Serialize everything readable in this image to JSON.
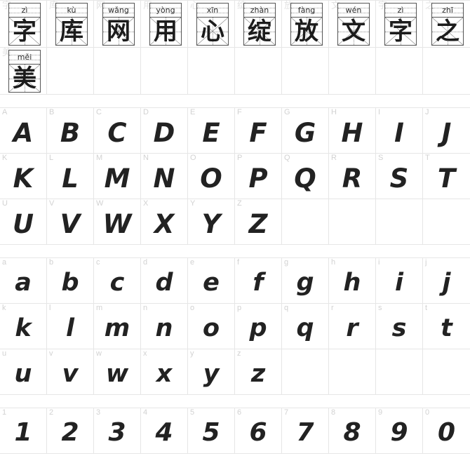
{
  "document": {
    "title": "Font specimen chart",
    "type": "font-preview-sheet"
  },
  "colors": {
    "grid_line": "#e6e6e6",
    "corner_label": "#d2d2d2",
    "glyph": "#222222",
    "cjk_glyph": "#1c1c1c",
    "box_border": "#555555",
    "guide_line": "#8e8e8e",
    "background": "#ffffff"
  },
  "cjk_section": {
    "name": "chinese-characters",
    "columns": 10,
    "cells": [
      {
        "char": "字",
        "pinyin": "zì"
      },
      {
        "char": "库",
        "pinyin": "kù"
      },
      {
        "char": "网",
        "pinyin": "wǎng"
      },
      {
        "char": "用",
        "pinyin": "yòng"
      },
      {
        "char": "心",
        "pinyin": "xīn"
      },
      {
        "char": "绽",
        "pinyin": "zhàn"
      },
      {
        "char": "放",
        "pinyin": "fàng"
      },
      {
        "char": "文",
        "pinyin": "wén"
      },
      {
        "char": "字",
        "pinyin": "zì"
      },
      {
        "char": "之",
        "pinyin": "zhī"
      },
      {
        "char": "美",
        "pinyin": "měi"
      }
    ],
    "phrase": "字库网用心绽放文字之美"
  },
  "uppercase_section": {
    "name": "uppercase-latin",
    "columns": 10,
    "glyphs": [
      "A",
      "B",
      "C",
      "D",
      "E",
      "F",
      "G",
      "H",
      "I",
      "J",
      "K",
      "L",
      "M",
      "N",
      "O",
      "P",
      "Q",
      "R",
      "S",
      "T",
      "U",
      "V",
      "W",
      "X",
      "Y",
      "Z",
      "",
      "",
      "",
      ""
    ]
  },
  "lowercase_section": {
    "name": "lowercase-latin",
    "columns": 10,
    "glyphs": [
      "a",
      "b",
      "c",
      "d",
      "e",
      "f",
      "g",
      "h",
      "i",
      "j",
      "k",
      "l",
      "m",
      "n",
      "o",
      "p",
      "q",
      "r",
      "s",
      "t",
      "u",
      "v",
      "w",
      "x",
      "y",
      "z",
      "",
      "",
      "",
      ""
    ]
  },
  "digit_section": {
    "name": "digits",
    "columns": 10,
    "glyphs": [
      "1",
      "2",
      "3",
      "4",
      "5",
      "6",
      "7",
      "8",
      "9",
      "0"
    ]
  }
}
